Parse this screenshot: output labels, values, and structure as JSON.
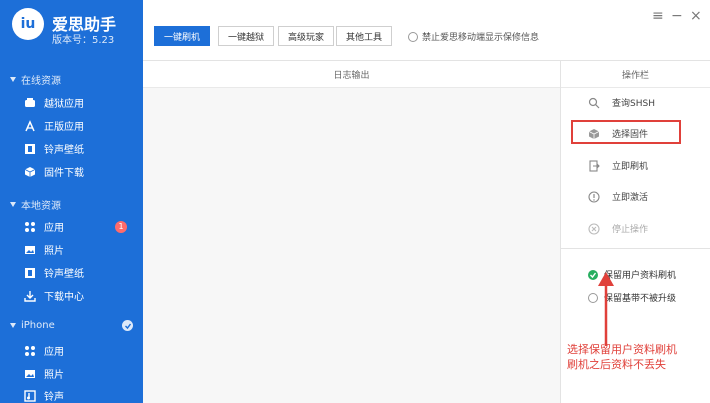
{
  "sidebar": {
    "app_title": "爱思助手",
    "version": "版本号：5.23",
    "online_title": "在线资源",
    "local_title": "本地资源",
    "iphone_title": "iPhone",
    "online_items": [
      {
        "label": "越狱应用",
        "icon": "box-icon"
      },
      {
        "label": "正版应用",
        "icon": "app-store-icon"
      },
      {
        "label": "铃声壁纸",
        "icon": "film-icon"
      },
      {
        "label": "固件下载",
        "icon": "cube-icon"
      }
    ],
    "local_items": [
      {
        "label": "应用",
        "icon": "apps-icon"
      },
      {
        "label": "照片",
        "icon": "photo-icon"
      },
      {
        "label": "铃声壁纸",
        "icon": "film-icon"
      },
      {
        "label": "下载中心",
        "icon": "download-icon"
      }
    ],
    "iphone_items": [
      {
        "label": "应用",
        "icon": "apps-icon"
      },
      {
        "label": "照片",
        "icon": "photo-icon"
      },
      {
        "label": "铃声",
        "icon": "ringtone-icon"
      }
    ],
    "local_badge": "1",
    "colors": {
      "bg": "#1d6fd8",
      "badge": "#ff6b6b"
    }
  },
  "topbar": {
    "tabs": [
      "一键刷机",
      "一键越狱",
      "高级玩家",
      "其他工具"
    ],
    "active_tab": "一键刷机",
    "checkbox_label": "禁止爱思移动端显示保修信息",
    "window_controls": [
      "≡",
      "−",
      "×"
    ]
  },
  "main": {
    "log_title": "日志输出",
    "ops_title": "操作栏"
  },
  "ops": {
    "items": [
      {
        "label": "查询SHSH",
        "icon": "search-icon",
        "enabled": true
      },
      {
        "label": "选择固件",
        "icon": "cube-icon",
        "enabled": true
      },
      {
        "label": "立即刷机",
        "icon": "flash-icon",
        "enabled": true
      },
      {
        "label": "立即激活",
        "icon": "info-icon",
        "enabled": true
      },
      {
        "label": "停止操作",
        "icon": "stop-icon",
        "enabled": false
      }
    ],
    "options": [
      {
        "label": "保留用户资料刷机",
        "checked": true
      },
      {
        "label": "保留基带不被升级",
        "checked": false
      }
    ]
  },
  "annotation": {
    "text_line1": "选择保留用户资料刷机",
    "text_line2": "刷机之后资料不丢失",
    "color": "#e0403a"
  }
}
